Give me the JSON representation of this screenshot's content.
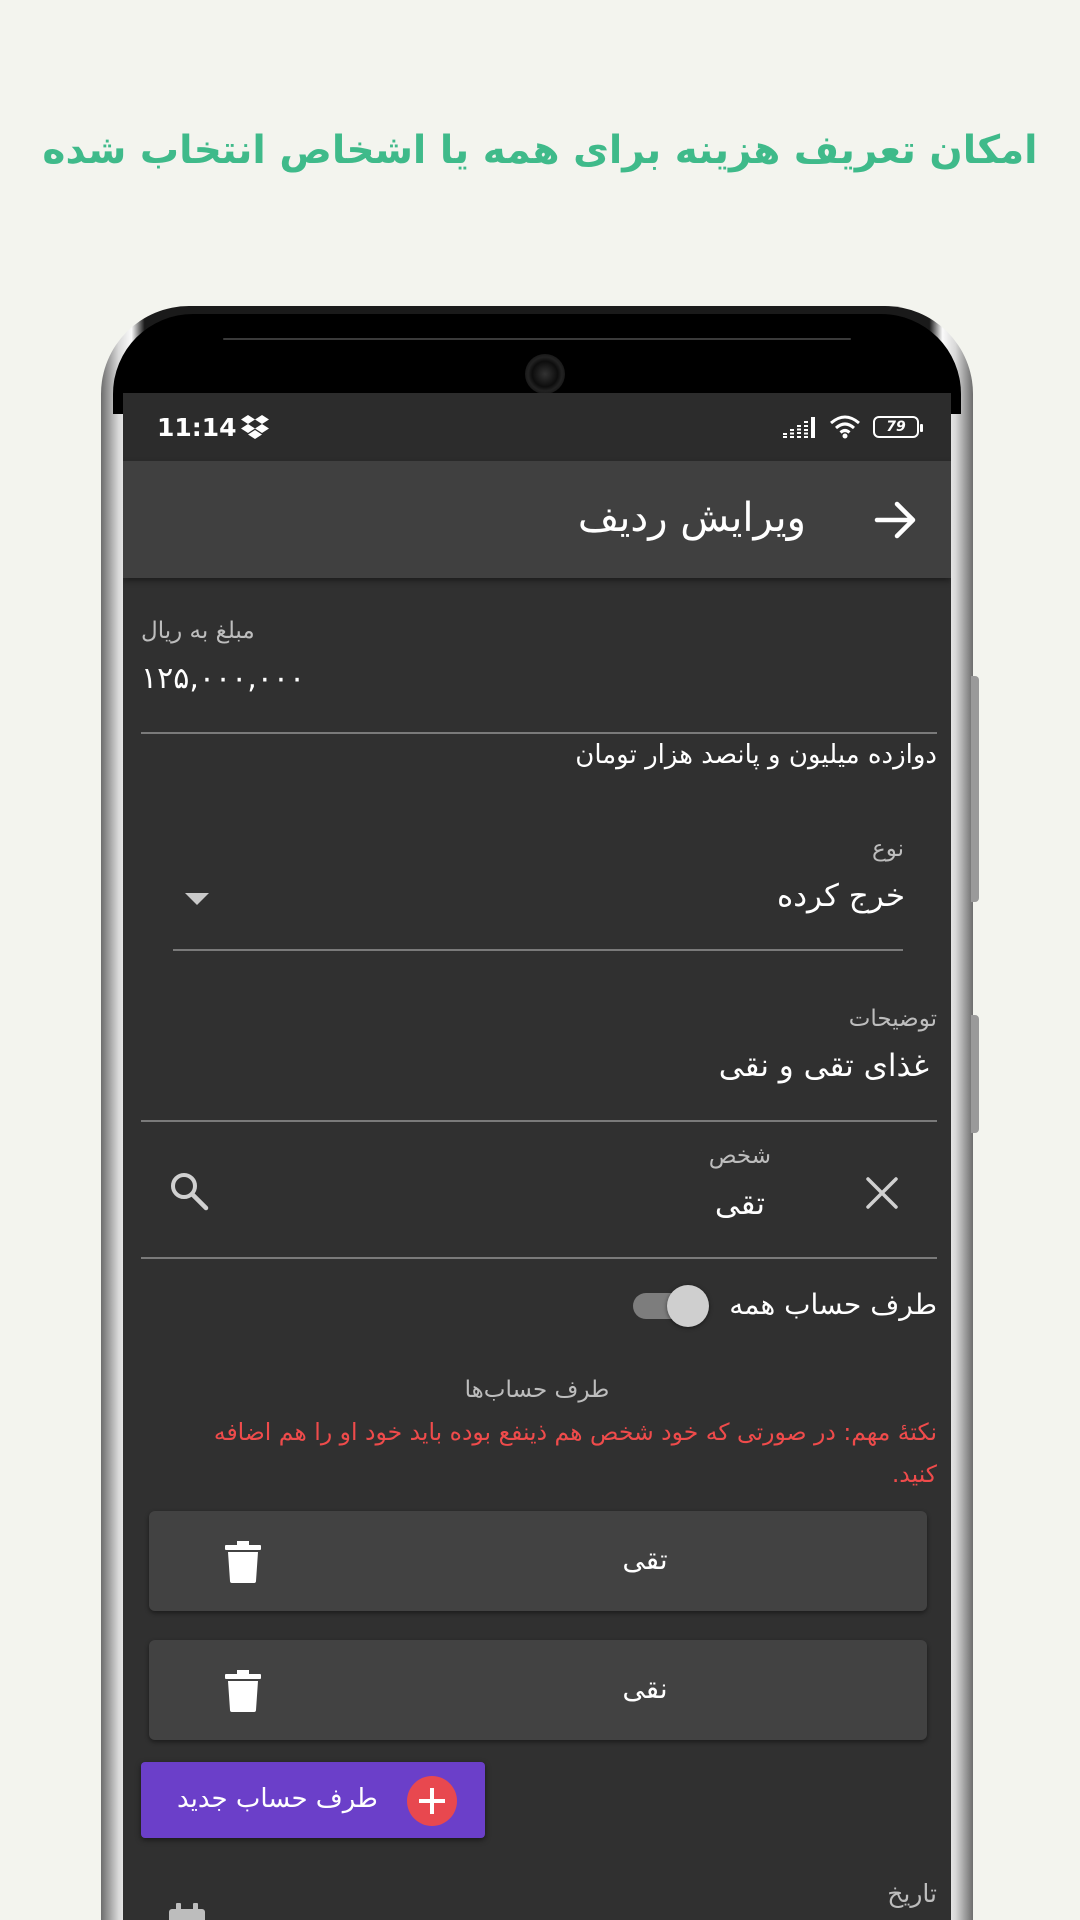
{
  "headline": "امکان تعریف هزینه برای همه یا اشخاص انتخاب شده",
  "status_bar": {
    "time": "11:14",
    "battery": "79",
    "icons": [
      "dropbox-icon",
      "signal-icon",
      "wifi-icon",
      "battery-icon"
    ]
  },
  "app_bar": {
    "title": "ویرایش ردیف",
    "back_icon": "arrow-right-icon"
  },
  "form": {
    "amount": {
      "label": "مبلغ به ریال",
      "value": "۱۲۵,۰۰۰,۰۰۰",
      "in_words": "دوازده میلیون و پانصد هزار تومان"
    },
    "type": {
      "label": "نوع",
      "value": "خرج کرده"
    },
    "description": {
      "label": "توضیحات",
      "value": "غذای تقی و نقی"
    },
    "person": {
      "label": "شخص",
      "value": "تقی"
    },
    "all_parties_toggle": {
      "label": "طرف حساب همه",
      "on": false
    },
    "parties": {
      "label": "طرف حساب‌ها",
      "note": "نکتهٔ مهم: در صورتی که خود شخص هم ذینفع بوده باید خود او را هم اضافه کنید.",
      "items": [
        {
          "name": "تقی"
        },
        {
          "name": "نقی"
        }
      ],
      "add_label": "طرف حساب جدید"
    },
    "date": {
      "label": "تاریخ"
    }
  },
  "colors": {
    "background": "#f3f4ee",
    "headline": "#3fba8a",
    "screen": "#303030",
    "appbar": "#404040",
    "note": "#ef4b4b",
    "add_button": "#6b3fc9",
    "add_plus": "#e8484f"
  }
}
